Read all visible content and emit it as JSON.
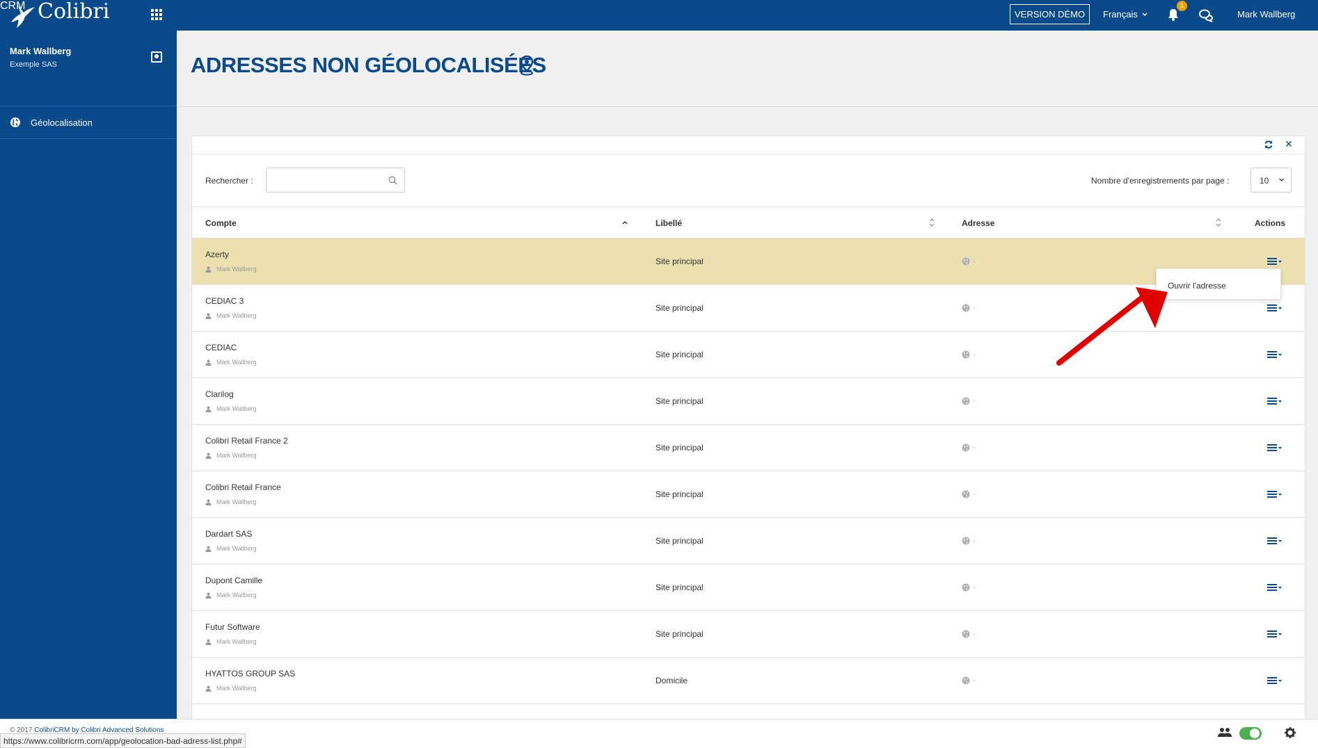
{
  "topbar": {
    "brand": "Colibri",
    "brand_sub": "CRM",
    "demo_label": "VERSION DÉMO",
    "language": "Français",
    "notif_count": "1",
    "user": "Mark Wallberg"
  },
  "sidebar": {
    "user_name": "Mark Wallberg",
    "company": "Exemple SAS",
    "items": [
      {
        "label": "Géolocalisation"
      }
    ]
  },
  "page": {
    "title": "ADRESSES NON GÉOLOCALISÉES"
  },
  "table_controls": {
    "search_label": "Rechercher :",
    "search_value": "",
    "perpage_label": "Nombre d'enregistrements par page :",
    "perpage_value": "10"
  },
  "table": {
    "columns": [
      "Compte",
      "Libellé",
      "Adresse",
      "Actions"
    ],
    "rows": [
      {
        "account": "Azerty",
        "owner": "Mark Wallberg",
        "label": "Site principal",
        "address": "-"
      },
      {
        "account": "CEDIAC 3",
        "owner": "Mark Wallberg",
        "label": "Site principal",
        "address": "-"
      },
      {
        "account": "CEDIAC",
        "owner": "Mark Wallberg",
        "label": "Site principal",
        "address": "-"
      },
      {
        "account": "Clarilog",
        "owner": "Mark Wallberg",
        "label": "Site principal",
        "address": "-"
      },
      {
        "account": "Colibri Retail France 2",
        "owner": "Mark Wallberg",
        "label": "Site principal",
        "address": "-"
      },
      {
        "account": "Colibri Retail France",
        "owner": "Mark Wallberg",
        "label": "Site principal",
        "address": "-"
      },
      {
        "account": "Dardart SAS",
        "owner": "Mark Wallberg",
        "label": "Site principal",
        "address": "-"
      },
      {
        "account": "Dupont Camille",
        "owner": "Mark Wallberg",
        "label": "Site principal",
        "address": "-"
      },
      {
        "account": "Futur Software",
        "owner": "Mark Wallberg",
        "label": "Site principal",
        "address": "-"
      },
      {
        "account": "HYATTOS GROUP SAS",
        "owner": "Mark Wallberg",
        "label": "Domicile",
        "address": "-"
      }
    ]
  },
  "dropdown": {
    "item": "Ouvrir l'adresse"
  },
  "footer": {
    "copyright_prefix": "© 2017",
    "copyright_link": "ColibriCRM by Colibri Advanced Solutions",
    "status_url": "https://www.colibricrm.com/app/geolocation-bad-adress-list.php#"
  },
  "colors": {
    "primary": "#0a4a8a",
    "row_highlight": "#ede0b0",
    "arrow": "#e00000",
    "toggle_on": "#4caf50"
  }
}
